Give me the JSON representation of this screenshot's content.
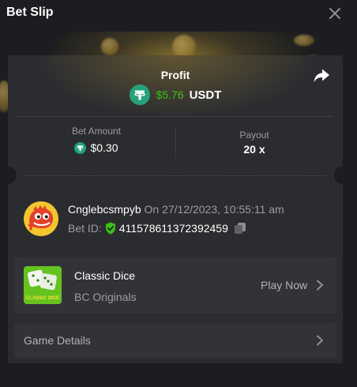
{
  "header": {
    "title": "Bet Slip",
    "close_icon": "close-icon"
  },
  "profit": {
    "label": "Profit",
    "value": "$5.76",
    "currency": "USDT",
    "value_color": "#3bc117",
    "coin_icon": "tether-icon",
    "share_icon": "share-icon"
  },
  "stats": {
    "bet_amount_label": "Bet Amount",
    "bet_amount_value": "$0.30",
    "payout_label": "Payout",
    "payout_value": "20 x"
  },
  "bet": {
    "username": "Cnglebcsmpyb",
    "timestamp": "On 27/12/2023, 10:55:11 am",
    "bet_id_label": "Bet ID:",
    "bet_id": "411578611372392459",
    "verified_icon": "shield-check-icon",
    "copy_icon": "copy-icon"
  },
  "game": {
    "name": "Classic Dice",
    "provider": "BC Originals",
    "play_label": "Play Now",
    "thumbnail_text": "CLASSIC DICE"
  },
  "details": {
    "label": "Game Details"
  },
  "colors": {
    "background": "#1c1d20",
    "card": "#2b2c30",
    "row": "#323338",
    "accent_green": "#3bc117",
    "tether": "#26a17b",
    "muted_text": "#9a9ca3"
  }
}
